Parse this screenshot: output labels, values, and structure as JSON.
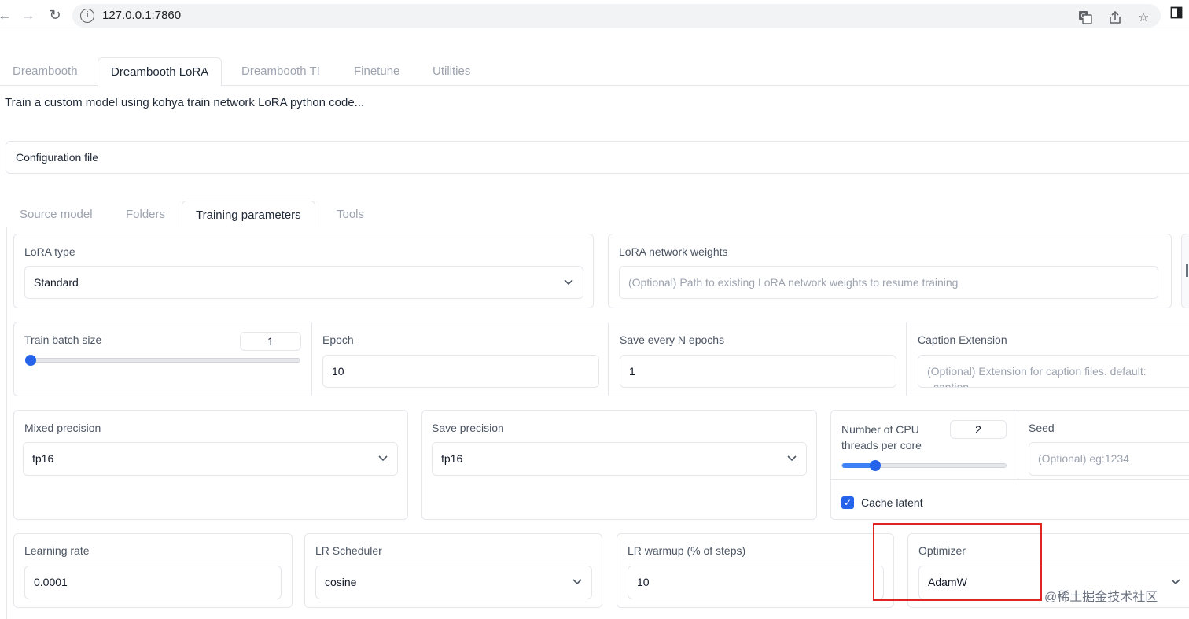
{
  "browser": {
    "url": "127.0.0.1:7860",
    "info_icon": "info-icon",
    "back_icon": "←",
    "forward_icon": "→",
    "reload_icon": "↻"
  },
  "top_tabs": [
    "Dreambooth",
    "Dreambooth LoRA",
    "Dreambooth TI",
    "Finetune",
    "Utilities"
  ],
  "top_tabs_active": "Dreambooth LoRA",
  "description": "Train a custom model using kohya train network LoRA python code...",
  "config_file": {
    "label": "Configuration file"
  },
  "inner_tabs": [
    "Source model",
    "Folders",
    "Training parameters",
    "Tools"
  ],
  "inner_tabs_active": "Training parameters",
  "lora_type": {
    "label": "LoRA type",
    "value": "Standard"
  },
  "lora_weights": {
    "label": "LoRA network weights",
    "placeholder": "(Optional) Path to existing LoRA network weights to resume training"
  },
  "train_batch_size": {
    "label": "Train batch size",
    "value": "1",
    "slider_fraction": 0.0
  },
  "epoch": {
    "label": "Epoch",
    "value": "10"
  },
  "save_every": {
    "label": "Save every N epochs",
    "value": "1"
  },
  "caption_ext": {
    "label": "Caption Extension",
    "placeholder_line1": "(Optional) Extension for caption files. default:",
    "placeholder_line2": ".caption"
  },
  "mixed_precision": {
    "label": "Mixed precision",
    "value": "fp16"
  },
  "save_precision": {
    "label": "Save precision",
    "value": "fp16"
  },
  "cpu_threads": {
    "label_line1": "Number of CPU",
    "label_line2": "threads per core",
    "value": "2",
    "slider_fraction": 0.2
  },
  "seed": {
    "label": "Seed",
    "placeholder": "(Optional) eg:1234"
  },
  "cache_latent": {
    "label": "Cache latent",
    "checked": true
  },
  "learning_rate": {
    "label": "Learning rate",
    "value": "0.0001"
  },
  "lr_scheduler": {
    "label": "LR Scheduler",
    "value": "cosine"
  },
  "lr_warmup": {
    "label": "LR warmup (% of steps)",
    "value": "10"
  },
  "optimizer": {
    "label": "Optimizer",
    "value": "AdamW"
  },
  "watermark": "@稀土掘金技术社区",
  "accent_color": "#2563eb",
  "highlight_color": "#e02424"
}
